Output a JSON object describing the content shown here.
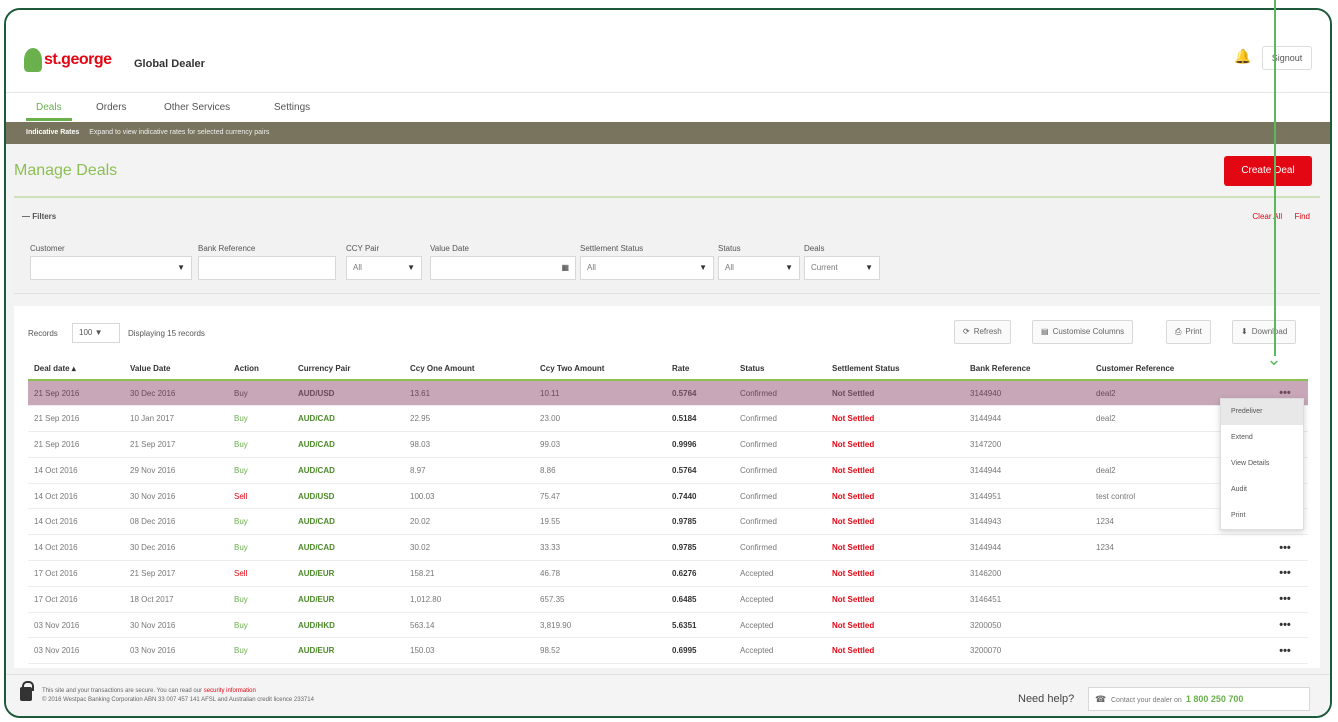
{
  "header": {
    "logo_text": "st.george",
    "app_name": "Global Dealer",
    "signout_label": "Signout"
  },
  "nav": {
    "tabs": [
      {
        "label": "Deals"
      },
      {
        "label": "Orders"
      },
      {
        "label": "Other Services"
      },
      {
        "label": "Settings"
      }
    ]
  },
  "notice": {
    "title": "Indicative Rates",
    "text": "Expand to view indicative rates for selected currency pairs"
  },
  "page": {
    "title": "Manage Deals",
    "create_label": "Create Deal"
  },
  "filters": {
    "toggle_label": "Filters",
    "clear_label": "Clear All",
    "find_label": "Find",
    "fields": [
      {
        "label": "Customer",
        "value": ""
      },
      {
        "label": "Bank Reference",
        "value": ""
      },
      {
        "label": "CCY Pair",
        "value": "All"
      },
      {
        "label": "Value Date",
        "value": ""
      },
      {
        "label": "Settlement Status",
        "value": "All"
      },
      {
        "label": "Status",
        "value": "All"
      },
      {
        "label": "Deals",
        "value": "Current"
      }
    ]
  },
  "table_tools": {
    "records_label": "Records",
    "records_value": "100",
    "count_text": "Displaying 15 records",
    "refresh_label": "Refresh",
    "customise_label": "Customise Columns",
    "print_label": "Print",
    "download_label": "Download"
  },
  "columns": [
    "Deal date",
    "Value Date",
    "Action",
    "Currency Pair",
    "Ccy One Amount",
    "Ccy Two Amount",
    "Rate",
    "Status",
    "Settlement Status",
    "Bank Reference",
    "Customer Reference",
    ""
  ],
  "rows": [
    [
      "21 Sep 2016",
      "30 Dec 2016",
      "Buy",
      "AUD/USD",
      "13.61",
      "10.11",
      "0.5764",
      "Confirmed",
      "Not Settled",
      "3144940",
      "deal2",
      "•••"
    ],
    [
      "21 Sep 2016",
      "10 Jan 2017",
      "Buy",
      "AUD/CAD",
      "22.95",
      "23.00",
      "0.5184",
      "Confirmed",
      "Not Settled",
      "3144944",
      "deal2",
      ""
    ],
    [
      "21 Sep 2016",
      "21 Sep 2017",
      "Buy",
      "AUD/CAD",
      "98.03",
      "99.03",
      "0.9996",
      "Confirmed",
      "Not Settled",
      "3147200",
      "",
      ""
    ],
    [
      "14 Oct 2016",
      "29 Nov 2016",
      "Buy",
      "AUD/CAD",
      "8.97",
      "8.86",
      "0.5764",
      "Confirmed",
      "Not Settled",
      "3144944",
      "deal2",
      ""
    ],
    [
      "14 Oct 2016",
      "30 Nov 2016",
      "Sell",
      "AUD/USD",
      "100.03",
      "75.47",
      "0.7440",
      "Confirmed",
      "Not Settled",
      "3144951",
      "test control",
      ""
    ],
    [
      "14 Oct 2016",
      "08 Dec 2016",
      "Buy",
      "AUD/CAD",
      "20.02",
      "19.55",
      "0.9785",
      "Confirmed",
      "Not Settled",
      "3144943",
      "1234",
      ""
    ],
    [
      "14 Oct 2016",
      "30 Dec 2016",
      "Buy",
      "AUD/CAD",
      "30.02",
      "33.33",
      "0.9785",
      "Confirmed",
      "Not Settled",
      "3144944",
      "1234",
      "•••"
    ],
    [
      "17 Oct 2016",
      "21 Sep 2017",
      "Sell",
      "AUD/EUR",
      "158.21",
      "46.78",
      "0.6276",
      "Accepted",
      "Not Settled",
      "3146200",
      "",
      "•••"
    ],
    [
      "17 Oct 2016",
      "18 Oct 2017",
      "Buy",
      "AUD/EUR",
      "1,012.80",
      "657.35",
      "0.6485",
      "Accepted",
      "Not Settled",
      "3146451",
      "",
      "•••"
    ],
    [
      "03 Nov 2016",
      "30 Nov 2016",
      "Buy",
      "AUD/HKD",
      "563.14",
      "3,819.90",
      "5.6351",
      "Accepted",
      "Not Settled",
      "3200050",
      "",
      "•••"
    ],
    [
      "03 Nov 2016",
      "03 Nov 2016",
      "Buy",
      "AUD/EUR",
      "150.03",
      "98.52",
      "0.6995",
      "Accepted",
      "Not Settled",
      "3200070",
      "",
      "•••"
    ]
  ],
  "row_menu": {
    "items": [
      "Predeliver",
      "Extend",
      "View Details",
      "Audit",
      "Print"
    ]
  },
  "footer": {
    "text_line1_pre": "This site and your transactions are secure. You can read our",
    "text_link": "security information",
    "text_line2": "© 2016 Westpac Banking Corporation ABN 33 007 457 141 AFSL and Australian credit licence 233714",
    "need_help": "Need help?",
    "contact_text": "Contact your dealer on",
    "contact_number": "1 800 250 700"
  },
  "colors": {
    "brand_green": "#6ab04c",
    "brand_red": "#e30613",
    "notice_bar": "#78745e",
    "highlight_row": "#c8a7b8"
  }
}
